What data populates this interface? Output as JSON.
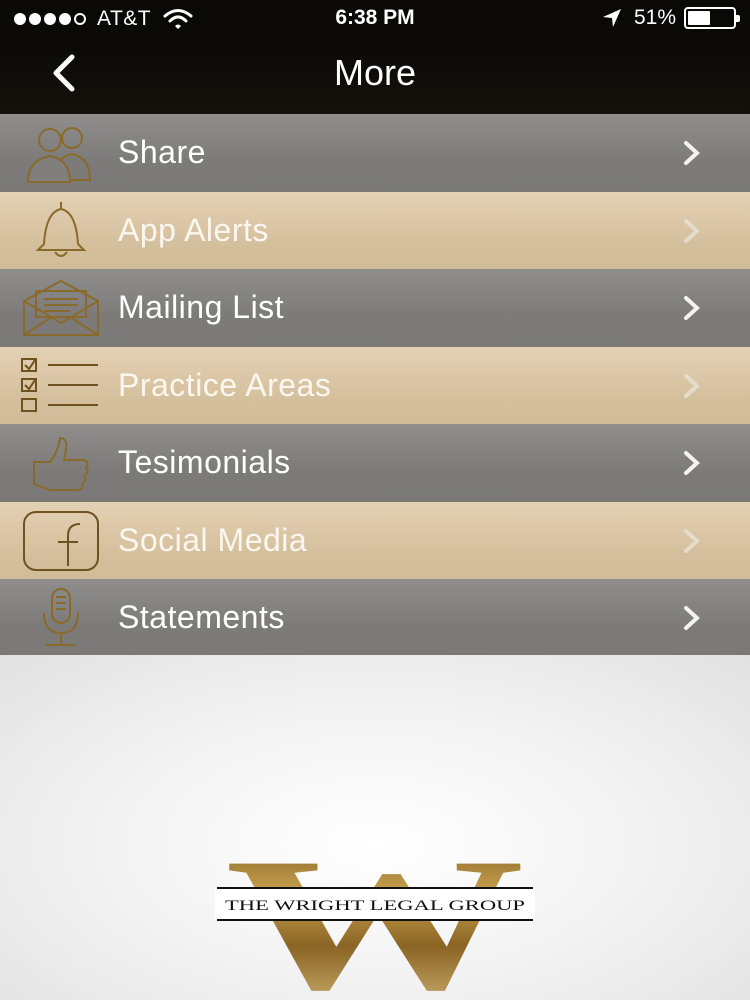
{
  "status_bar": {
    "carrier": "AT&T",
    "time": "6:38 PM",
    "battery_percent_label": "51%",
    "battery_level": 0.51,
    "signal_bars": 4,
    "signal_max": 5
  },
  "nav": {
    "title": "More",
    "back_icon": "chevron-left-icon"
  },
  "menu": {
    "items": [
      {
        "label": "Share",
        "icon": "people-icon",
        "style": "gray"
      },
      {
        "label": "App Alerts",
        "icon": "bell-icon",
        "style": "tan"
      },
      {
        "label": "Mailing List",
        "icon": "envelope-icon",
        "style": "gray"
      },
      {
        "label": "Practice Areas",
        "icon": "checklist-icon",
        "style": "tan"
      },
      {
        "label": "Tesimonials",
        "icon": "thumbs-up-icon",
        "style": "gray"
      },
      {
        "label": "Social Media",
        "icon": "facebook-icon",
        "style": "tan"
      },
      {
        "label": "Statements",
        "icon": "microphone-icon",
        "style": "gray"
      }
    ]
  },
  "logo": {
    "monogram": "W",
    "name": "THE WRIGHT LEGAL GROUP"
  },
  "colors": {
    "bar_background": "#0a0906",
    "row_gray": "#807f7d",
    "row_tan": "#d8c4a2",
    "icon_gold": "#8a6a2a",
    "logo_gold": "#b08a3a"
  }
}
